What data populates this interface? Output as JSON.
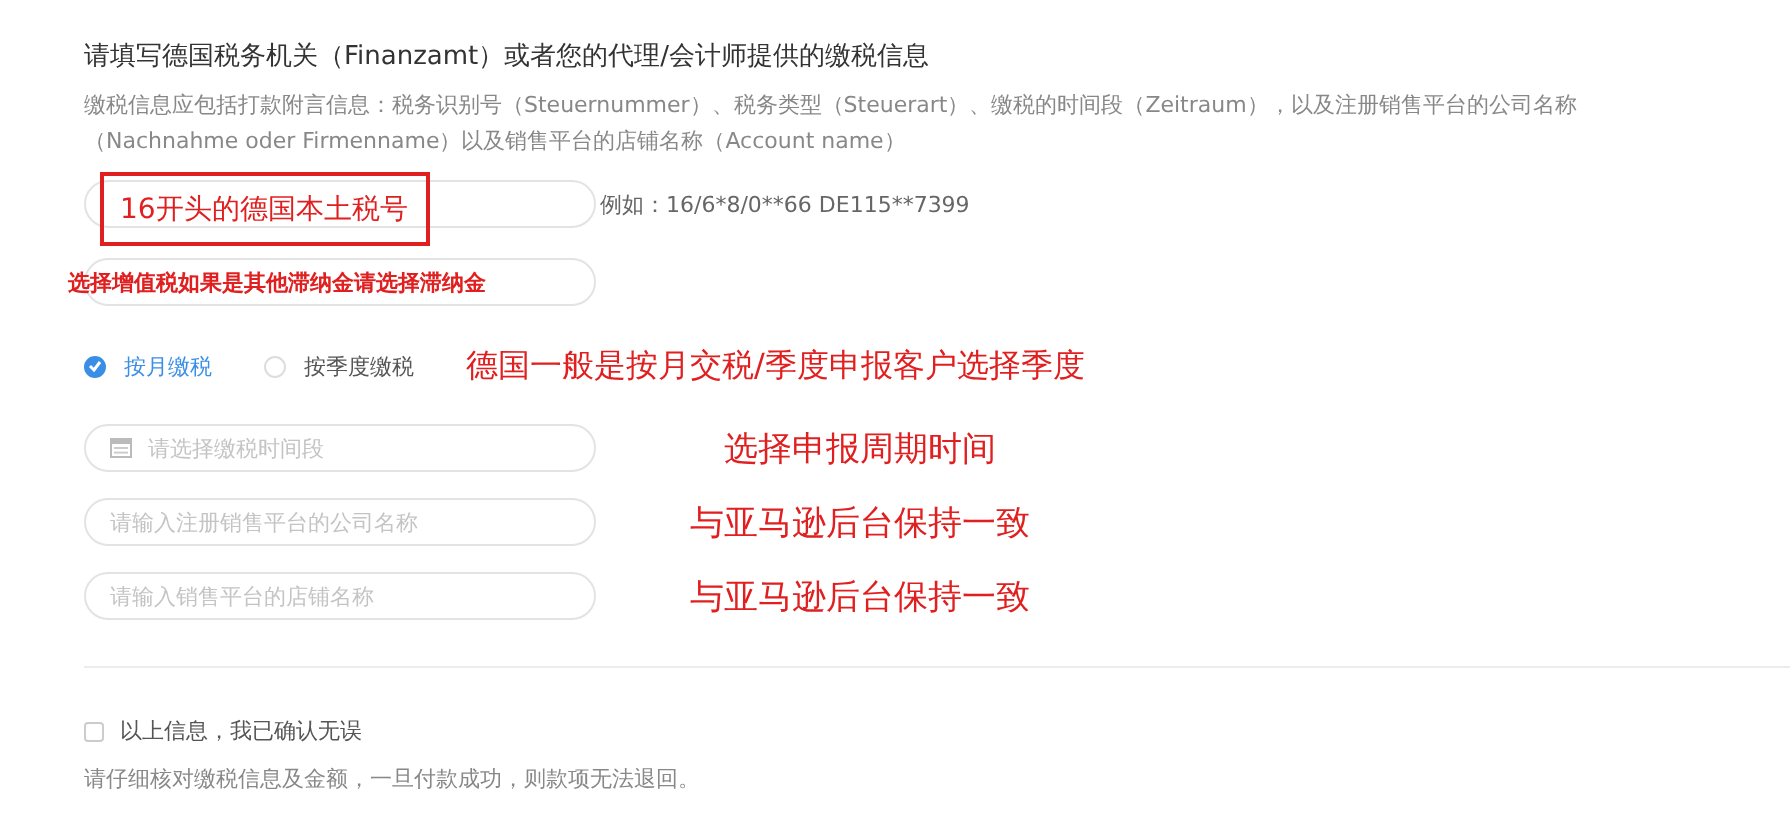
{
  "form": {
    "title": "请填写德国税务机关（Finanzamt）或者您的代理/会计师提供的缴税信息",
    "description": "缴税信息应包括打款附言信息：税务识别号（Steuernummer）、税务类型（Steuerart）、缴税的时间段（Zeitraum），以及注册销售平台的公司名称（Nachnahme oder Firmenname）以及销售平台的店铺名称（Account name）",
    "tax_number_field": {
      "annotation": "16开头的德国本土税号",
      "hint": "例如：16/6*8/0**66 DE115**7399"
    },
    "tax_type_field": {
      "annotation": "选择增值税如果是其他滞纳金请选择滞纳金"
    },
    "period_options": [
      {
        "label": "按月缴税",
        "selected": true
      },
      {
        "label": "按季度缴税",
        "selected": false
      }
    ],
    "period_annotation": "德国一般是按月交税/季度申报客户选择季度",
    "fields": [
      {
        "kind": "date",
        "placeholder": "请选择缴税时间段",
        "annotation": "选择申报周期时间"
      },
      {
        "kind": "text",
        "placeholder": "请输入注册销售平台的公司名称",
        "annotation": "与亚马逊后台保持一致"
      },
      {
        "kind": "text",
        "placeholder": "请输入销售平台的店铺名称",
        "annotation": "与亚马逊后台保持一致"
      }
    ],
    "confirm": {
      "label": "以上信息，我已确认无误",
      "checked": false
    },
    "notice": "请仔细核对缴税信息及金额，一旦付款成功，则款项无法退回。"
  }
}
